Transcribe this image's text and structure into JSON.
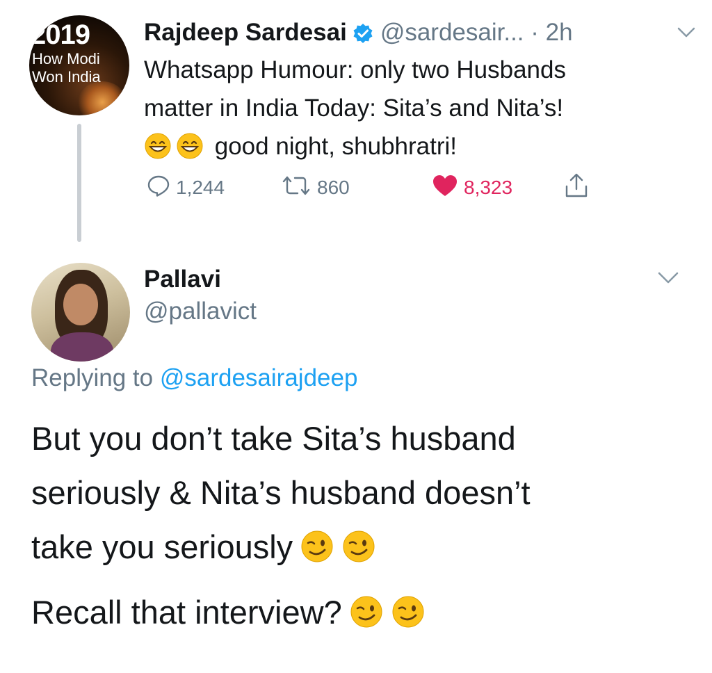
{
  "original_tweet": {
    "avatar": {
      "year": "2019",
      "line1": "How Modi",
      "line2": "Won India"
    },
    "author_name": "Rajdeep Sardesai",
    "verified_icon": "verified-badge-icon",
    "handle": "@sardesair...",
    "time": "· 2h",
    "text_line1": "Whatsapp Humour: only two Husbands",
    "text_line2": "matter in India Today: Sita’s and Nita’s!",
    "text_line3": "good night, shubhratri!",
    "line3_emojis": [
      "grinning-face-emoji",
      "grinning-face-emoji"
    ],
    "replies_count": "1,244",
    "retweets_count": "860",
    "likes_count": "8,323"
  },
  "reply_tweet": {
    "author_name": "Pallavi",
    "handle": "@pallavict",
    "replying_to_label": "Replying to",
    "replying_to_handle": "@sardesairajdeep",
    "text_line1": "But you don’t take Sita’s husband",
    "text_line2": "seriously & Nita’s husband doesn’t",
    "text_line3": "take you seriously",
    "text_line4": "Recall that interview?",
    "emojis": [
      "winking-face-emoji",
      "winking-face-emoji"
    ]
  },
  "colors": {
    "text": "#14171a",
    "secondary": "#657786",
    "link": "#1da1f2",
    "like": "#e0245e",
    "verified": "#1da1f2",
    "thread_line": "#c9ced3"
  }
}
